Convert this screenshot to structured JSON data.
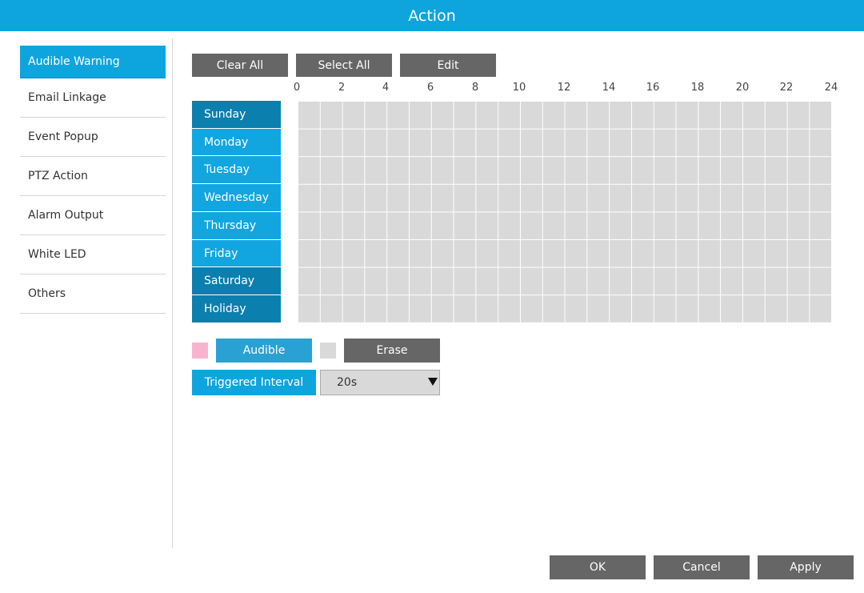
{
  "window": {
    "title": "Action"
  },
  "sidebar": {
    "items": [
      {
        "label": "Audible Warning"
      },
      {
        "label": "Email Linkage"
      },
      {
        "label": "Event Popup"
      },
      {
        "label": "PTZ Action"
      },
      {
        "label": "Alarm Output"
      },
      {
        "label": "White LED"
      },
      {
        "label": "Others"
      }
    ]
  },
  "toolbar": {
    "clear_all": "Clear All",
    "select_all": "Select All",
    "edit": "Edit"
  },
  "schedule": {
    "hours": [
      "0",
      "2",
      "4",
      "6",
      "8",
      "10",
      "12",
      "14",
      "16",
      "18",
      "20",
      "22",
      "24"
    ],
    "days": [
      "Sunday",
      "Monday",
      "Tuesday",
      "Wednesday",
      "Thursday",
      "Friday",
      "Saturday",
      "Holiday"
    ],
    "colors": {
      "selected": "#f8b4cf",
      "empty": "#d9d9d9"
    }
  },
  "legend": {
    "audible_label": "Audible",
    "erase_label": "Erase"
  },
  "interval": {
    "label": "Triggered Interval",
    "value": "20s"
  },
  "footer": {
    "ok": "OK",
    "cancel": "Cancel",
    "apply": "Apply"
  },
  "colors": {
    "accent": "#0ea5df",
    "dark_day": "#0b7fae",
    "button": "#666666"
  }
}
